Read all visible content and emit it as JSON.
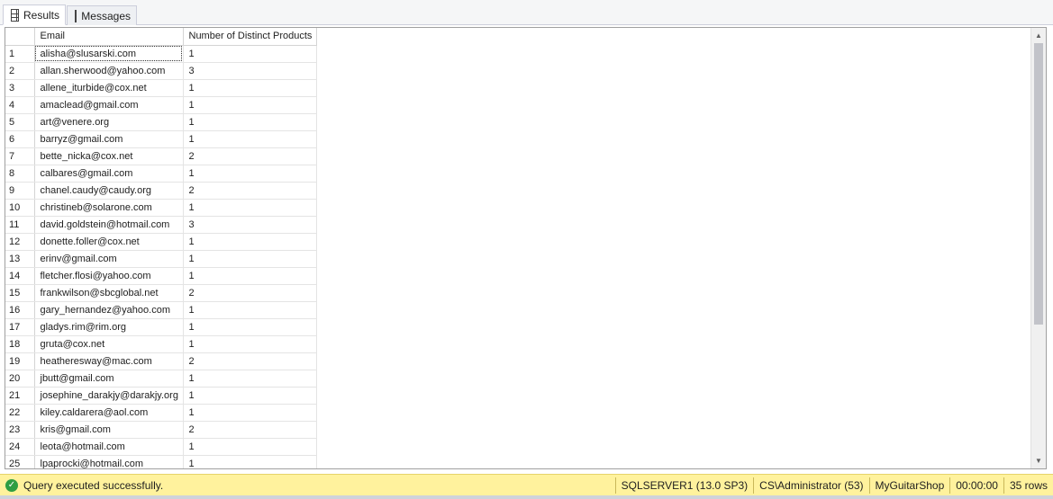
{
  "tabs": [
    {
      "label": "Results",
      "icon": "grid-icon",
      "active": true
    },
    {
      "label": "Messages",
      "icon": "messages-icon",
      "active": false
    }
  ],
  "grid": {
    "columns": [
      "Email",
      "Number of Distinct Products"
    ],
    "rows": [
      {
        "n": "1",
        "email": "alisha@slusarski.com",
        "count": "1"
      },
      {
        "n": "2",
        "email": "allan.sherwood@yahoo.com",
        "count": "3"
      },
      {
        "n": "3",
        "email": "allene_iturbide@cox.net",
        "count": "1"
      },
      {
        "n": "4",
        "email": "amaclead@gmail.com",
        "count": "1"
      },
      {
        "n": "5",
        "email": "art@venere.org",
        "count": "1"
      },
      {
        "n": "6",
        "email": "barryz@gmail.com",
        "count": "1"
      },
      {
        "n": "7",
        "email": "bette_nicka@cox.net",
        "count": "2"
      },
      {
        "n": "8",
        "email": "calbares@gmail.com",
        "count": "1"
      },
      {
        "n": "9",
        "email": "chanel.caudy@caudy.org",
        "count": "2"
      },
      {
        "n": "10",
        "email": "christineb@solarone.com",
        "count": "1"
      },
      {
        "n": "11",
        "email": "david.goldstein@hotmail.com",
        "count": "3"
      },
      {
        "n": "12",
        "email": "donette.foller@cox.net",
        "count": "1"
      },
      {
        "n": "13",
        "email": "erinv@gmail.com",
        "count": "1"
      },
      {
        "n": "14",
        "email": "fletcher.flosi@yahoo.com",
        "count": "1"
      },
      {
        "n": "15",
        "email": "frankwilson@sbcglobal.net",
        "count": "2"
      },
      {
        "n": "16",
        "email": "gary_hernandez@yahoo.com",
        "count": "1"
      },
      {
        "n": "17",
        "email": "gladys.rim@rim.org",
        "count": "1"
      },
      {
        "n": "18",
        "email": "gruta@cox.net",
        "count": "1"
      },
      {
        "n": "19",
        "email": "heatheresway@mac.com",
        "count": "2"
      },
      {
        "n": "20",
        "email": "jbutt@gmail.com",
        "count": "1"
      },
      {
        "n": "21",
        "email": "josephine_darakjy@darakjy.org",
        "count": "1"
      },
      {
        "n": "22",
        "email": "kiley.caldarera@aol.com",
        "count": "1"
      },
      {
        "n": "23",
        "email": "kris@gmail.com",
        "count": "2"
      },
      {
        "n": "24",
        "email": "leota@hotmail.com",
        "count": "1"
      },
      {
        "n": "25",
        "email": "lpaprocki@hotmail.com",
        "count": "1"
      }
    ]
  },
  "scrollbar": {
    "up_glyph": "▲",
    "down_glyph": "▼"
  },
  "status": {
    "message": "Query executed successfully.",
    "server": "SQLSERVER1 (13.0 SP3)",
    "user": "CS\\Administrator (53)",
    "database": "MyGuitarShop",
    "elapsed": "00:00:00",
    "rows": "35 rows",
    "ok_glyph": "✓"
  }
}
